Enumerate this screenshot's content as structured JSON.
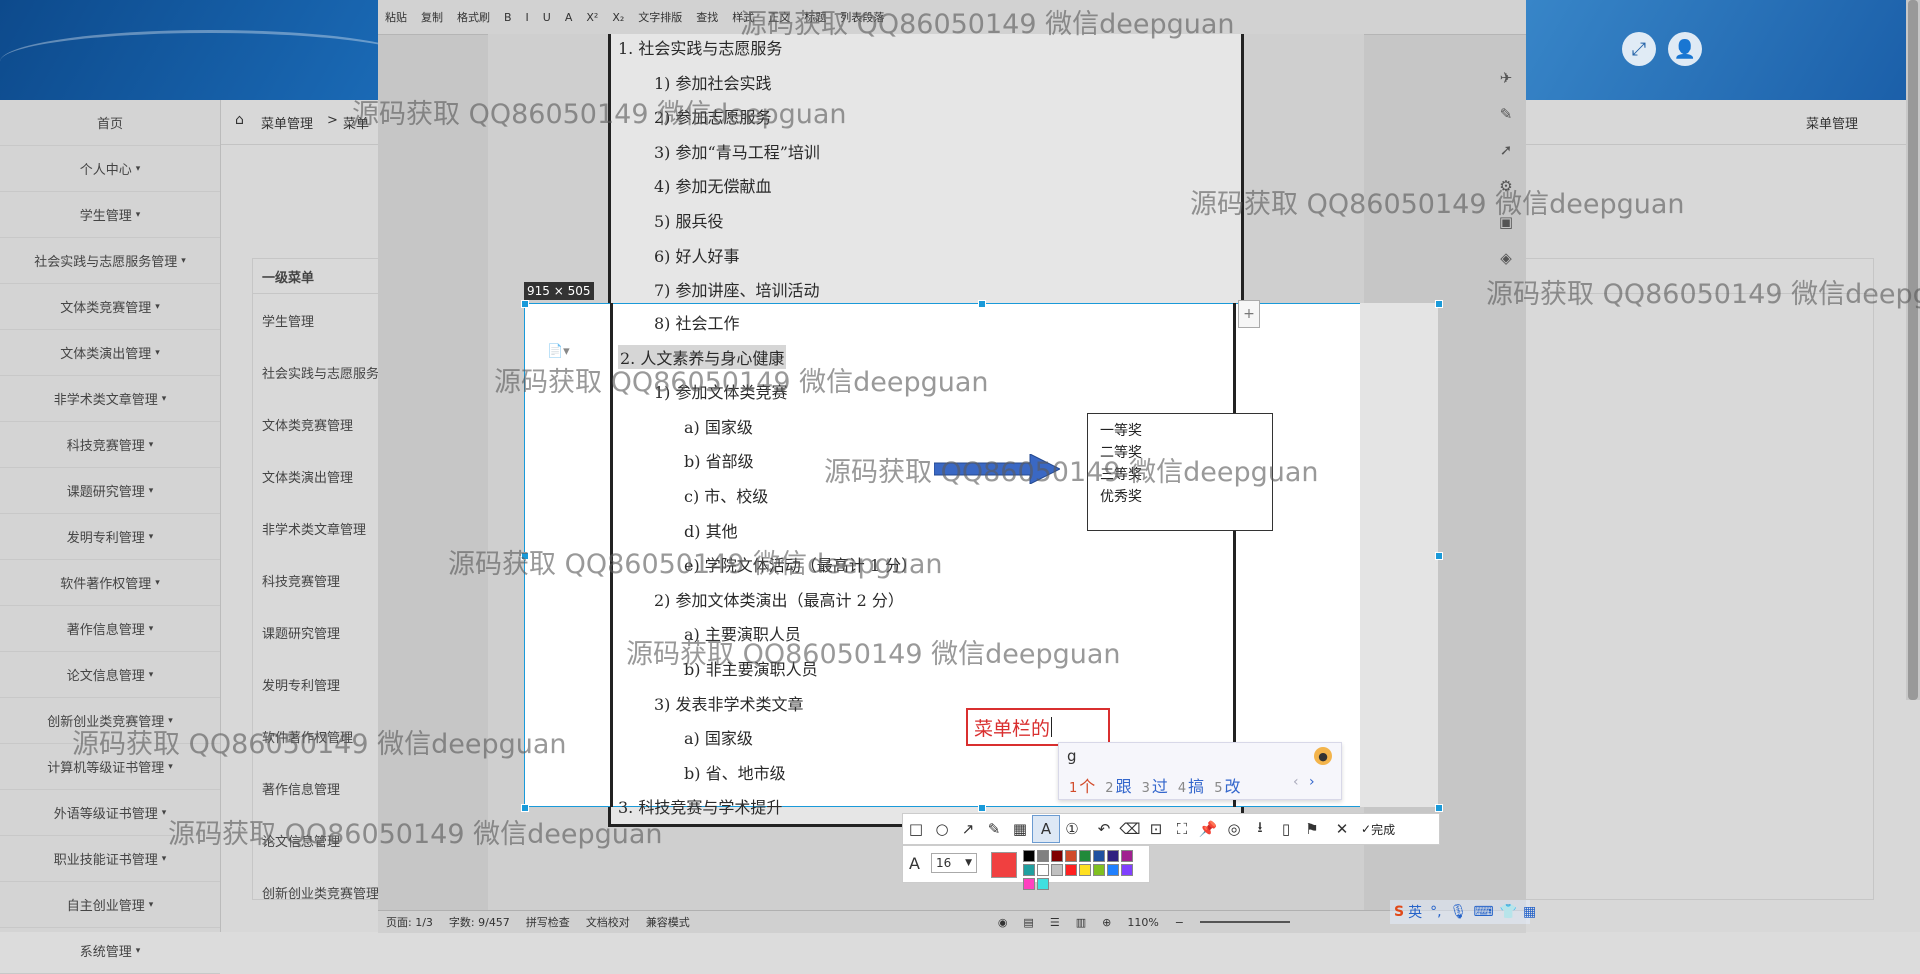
{
  "app": {
    "breadcrumb_home": "菜单管理",
    "breadcrumb_sep": ">",
    "breadcrumb_current": "菜单",
    "right_title": "菜单管理",
    "sidebar": [
      {
        "label": "首页",
        "caret": false
      },
      {
        "label": "个人中心",
        "caret": true
      },
      {
        "label": "学生管理",
        "caret": true
      },
      {
        "label": "社会实践与志愿服务管理",
        "caret": true
      },
      {
        "label": "文体类竞赛管理",
        "caret": true
      },
      {
        "label": "文体类演出管理",
        "caret": true
      },
      {
        "label": "非学术类文章管理",
        "caret": true
      },
      {
        "label": "科技竞赛管理",
        "caret": true
      },
      {
        "label": "课题研究管理",
        "caret": true
      },
      {
        "label": "发明专利管理",
        "caret": true
      },
      {
        "label": "软件著作权管理",
        "caret": true
      },
      {
        "label": "著作信息管理",
        "caret": true
      },
      {
        "label": "论文信息管理",
        "caret": true
      },
      {
        "label": "创新创业类竞赛管理",
        "caret": true
      },
      {
        "label": "计算机等级证书管理",
        "caret": true
      },
      {
        "label": "外语等级证书管理",
        "caret": true
      },
      {
        "label": "职业技能证书管理",
        "caret": true
      },
      {
        "label": "自主创业管理",
        "caret": true
      },
      {
        "label": "系统管理",
        "caret": true
      }
    ],
    "table_header": "一级菜单",
    "table_rows": [
      "学生管理",
      "社会实践与志愿服务",
      "文体类竞赛管理",
      "文体类演出管理",
      "非学术类文章管理",
      "科技竞赛管理",
      "课题研究管理",
      "发明专利管理",
      "软件著作权管理",
      "著作信息管理",
      "论文信息管理",
      "创新创业类竞赛管理"
    ]
  },
  "doc": {
    "ribbon": [
      "粘贴",
      "复制",
      "格式刷",
      "B",
      "I",
      "U",
      "A",
      "X²",
      "X₂",
      "文字排版",
      "查找",
      "样式",
      "正文",
      "标题",
      "列表段落"
    ],
    "status": {
      "page": "页面: 1/3",
      "words": "字数: 9/457",
      "spell": "拼写检查",
      "proof": "文档校对",
      "compat": "兼容模式",
      "zoom": "110%"
    },
    "lines_above": [
      {
        "text": "1.  社会实践与志愿服务",
        "level": 0
      },
      {
        "text": "1)   参加社会实践",
        "level": 1
      },
      {
        "text": "2)   参加志愿服务",
        "level": 1
      },
      {
        "text": "3)   参加“青马工程”培训",
        "level": 1
      },
      {
        "text": "4)   参加无偿献血",
        "level": 1
      },
      {
        "text": "5)   服兵役",
        "level": 1
      },
      {
        "text": "6)   好人好事",
        "level": 1
      },
      {
        "text": "7)   参加讲座、培训活动",
        "level": 1
      }
    ],
    "lines_capture": [
      {
        "text": "8)   社会工作",
        "level": 1
      },
      {
        "text": "2.  人文素养与身心健康",
        "level": 0,
        "highlight": true
      },
      {
        "text": "1)   参加文体类竞赛",
        "level": 1
      },
      {
        "text": "a)   国家级",
        "level": 2
      },
      {
        "text": "b)   省部级",
        "level": 2
      },
      {
        "text": "c)   市、校级",
        "level": 2
      },
      {
        "text": "d)   其他",
        "level": 2
      },
      {
        "text": "e)   学院文体活动（最高计 1 分）",
        "level": 2
      },
      {
        "text": "2)   参加文体类演出（最高计 2 分）",
        "level": 1
      },
      {
        "text": "a)   主要演职人员",
        "level": 2
      },
      {
        "text": "b)   非主要演职人员",
        "level": 2
      },
      {
        "text": "3)   发表非学术类文章",
        "level": 1
      },
      {
        "text": "a)   国家级",
        "level": 2
      },
      {
        "text": "b)   省、地市级",
        "level": 2
      },
      {
        "text": "3.  科技竞赛与学术提升",
        "level": 0
      }
    ],
    "prizes": [
      "一等奖",
      "二等奖",
      "三等奖",
      "优秀奖"
    ]
  },
  "capture": {
    "size_label": "915 × 505",
    "annotation_text": "菜单栏的",
    "ime_typed": "g",
    "ime_candidates": [
      {
        "num": "1",
        "word": "个"
      },
      {
        "num": "2",
        "word": "跟"
      },
      {
        "num": "3",
        "word": "过"
      },
      {
        "num": "4",
        "word": "搞"
      },
      {
        "num": "5",
        "word": "改"
      }
    ],
    "done_label": "完成",
    "font_size": "16",
    "current_color": "#f04040",
    "palette": [
      "#000000",
      "#808080",
      "#800000",
      "#d04a2a",
      "#208a3a",
      "#2050a0",
      "#302080",
      "#a02090",
      "#20a0a0",
      "#ffffff",
      "#c0c0c0",
      "#ff2020",
      "#ffe020",
      "#80c020",
      "#2080ff",
      "#8040ff",
      "#ff40c0",
      "#40e0e0"
    ],
    "plus": "+",
    "tray_lang": "英"
  },
  "watermarks": [
    {
      "text": "源码获取 QQ86050149 微信deepguan",
      "id": "top"
    },
    {
      "text": "源码获取 QQ86050149 微信deepguan",
      "id": "upper-left"
    },
    {
      "text": "源码获取 QQ86050149 微信deepguan",
      "id": "upper-right"
    },
    {
      "text": "源码获取 QQ86050149 微信deepguan",
      "id": "far-right"
    },
    {
      "text": "源码获取 QQ86050149 微信deepguan",
      "id": "mid-left"
    },
    {
      "text": "源码获取 QQ86050149 微信deepguan",
      "id": "mid"
    },
    {
      "text": "源码获取 QQ86050149 微信deepguan",
      "id": "mid-lower"
    },
    {
      "text": "源码获取 QQ86050149 微信deepguan",
      "id": "lower"
    },
    {
      "text": "源码获取 QQ86050149 微信deepguan",
      "id": "bottom-left"
    },
    {
      "text": "源码获取 QQ86050149 微信deepguan",
      "id": "bottom"
    }
  ]
}
